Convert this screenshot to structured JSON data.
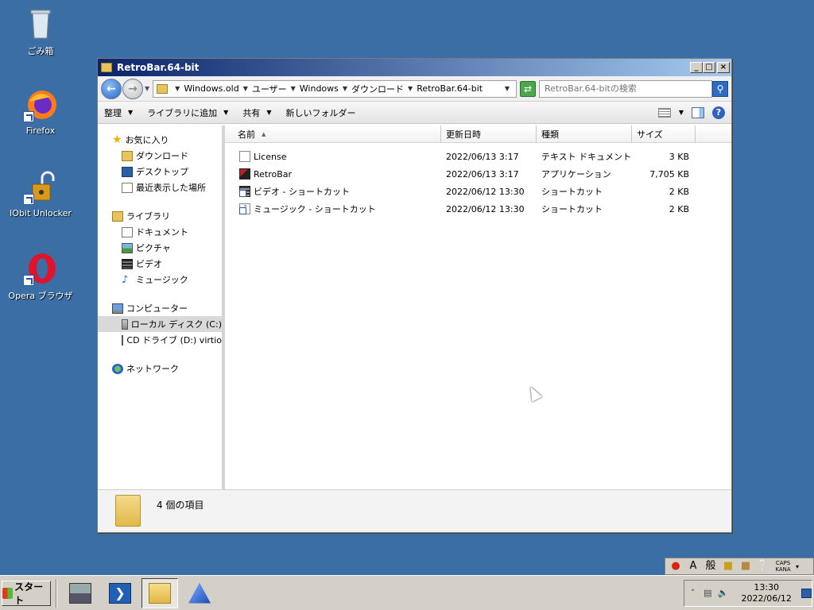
{
  "desktop": {
    "icons": [
      {
        "label": "ごみ箱"
      },
      {
        "label": "Firefox"
      },
      {
        "label": "IObit Unlocker"
      },
      {
        "label": "Opera ブラウザ"
      }
    ]
  },
  "window": {
    "title": "RetroBar.64-bit",
    "controls": {
      "minimize": "_",
      "maximize": "□",
      "close": "×"
    }
  },
  "address": {
    "crumbs": [
      "Windows.old",
      "ユーザー",
      "Windows",
      "ダウンロード",
      "RetroBar.64-bit"
    ],
    "search_placeholder": "RetroBar.64-bitの検索"
  },
  "commands": {
    "organize": "整理",
    "add_to_library": "ライブラリに追加",
    "share": "共有",
    "new_folder": "新しいフォルダー"
  },
  "nav": {
    "favorites": "お気に入り",
    "fav_items": [
      "ダウンロード",
      "デスクトップ",
      "最近表示した場所"
    ],
    "libraries": "ライブラリ",
    "lib_items": [
      "ドキュメント",
      "ピクチャ",
      "ビデオ",
      "ミュージック"
    ],
    "computer": "コンピューター",
    "computer_items": [
      "ローカル ディスク (C:)",
      "CD ドライブ (D:) virtio"
    ],
    "network": "ネットワーク"
  },
  "columns": {
    "name": "名前",
    "date": "更新日時",
    "type": "種類",
    "size": "サイズ"
  },
  "files": [
    {
      "name": "License",
      "date": "2022/06/13 3:17",
      "type": "テキスト ドキュメント",
      "size": "3 KB"
    },
    {
      "name": "RetroBar",
      "date": "2022/06/13 3:17",
      "type": "アプリケーション",
      "size": "7,705 KB"
    },
    {
      "name": "ビデオ - ショートカット",
      "date": "2022/06/12 13:30",
      "type": "ショートカット",
      "size": "2 KB"
    },
    {
      "name": "ミュージック - ショートカット",
      "date": "2022/06/12 13:30",
      "type": "ショートカット",
      "size": "2 KB"
    }
  ],
  "details": {
    "count": "4 個の項目"
  },
  "ime": {
    "mode": "A",
    "kanji": "般",
    "caps": "CAPS",
    "kana": "KANA"
  },
  "taskbar": {
    "start": "スタート",
    "time": "13:30",
    "date": "2022/06/12"
  }
}
